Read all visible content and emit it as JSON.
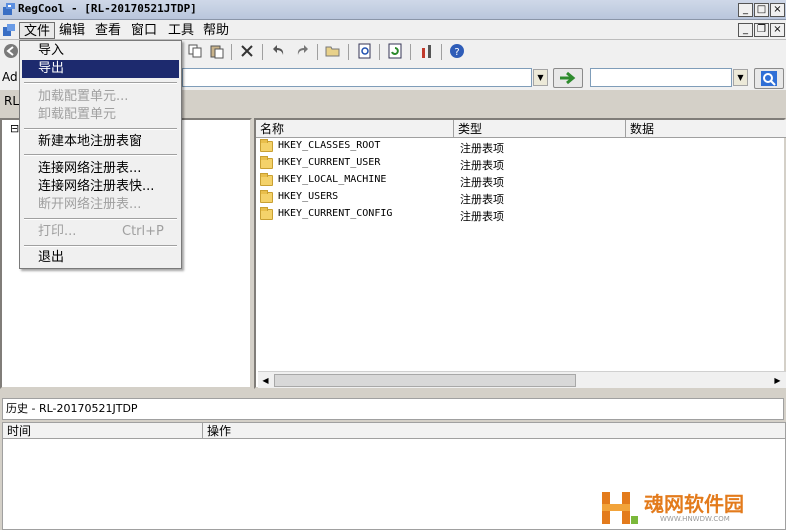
{
  "window": {
    "title": "RegCool - [RL-20170521JTDP]"
  },
  "title_controls": {
    "minimize": "_",
    "maximize": "□",
    "close": "×"
  },
  "mdi_controls": {
    "minimize": "_",
    "restore": "❐",
    "close": "×"
  },
  "menubar": {
    "items": [
      "文件",
      "编辑",
      "查看",
      "窗口",
      "工具",
      "帮助"
    ]
  },
  "address": {
    "label": "Ad",
    "value": "",
    "search_value": ""
  },
  "tab": {
    "label": "RL"
  },
  "tree": {
    "collapse_marker": "⊟"
  },
  "file_menu": {
    "items": [
      {
        "label": "导入",
        "state": "normal"
      },
      {
        "label": "导出",
        "state": "selected"
      },
      {
        "label": "加载配置单元...",
        "state": "disabled"
      },
      {
        "label": "卸载配置单元",
        "state": "disabled"
      },
      {
        "label": "新建本地注册表窗",
        "state": "normal"
      },
      {
        "label": "连接网络注册表...",
        "state": "normal"
      },
      {
        "label": "连接网络注册表快...",
        "state": "normal"
      },
      {
        "label": "断开网络注册表...",
        "state": "disabled"
      },
      {
        "label": "打印...",
        "state": "disabled",
        "shortcut": "Ctrl+P"
      },
      {
        "label": "退出",
        "state": "normal"
      }
    ]
  },
  "list": {
    "columns": [
      "名称",
      "类型",
      "数据"
    ],
    "rows": [
      {
        "name": "HKEY_CLASSES_ROOT",
        "type": "注册表项"
      },
      {
        "name": "HKEY_CURRENT_USER",
        "type": "注册表项"
      },
      {
        "name": "HKEY_LOCAL_MACHINE",
        "type": "注册表项"
      },
      {
        "name": "HKEY_USERS",
        "type": "注册表项"
      },
      {
        "name": "HKEY_CURRENT_CONFIG",
        "type": "注册表项"
      }
    ]
  },
  "history": {
    "title": "历史 - RL-20170521JTDP",
    "columns": [
      "时间",
      "操作"
    ]
  },
  "watermark": {
    "text": "魂网软件园",
    "url": "WWW.HNWDW.COM",
    "logo_letter": "H"
  },
  "colors": {
    "menu_highlight": "#1d2a6e",
    "folder": "#f4d26a",
    "watermark": "#e37b1c"
  }
}
